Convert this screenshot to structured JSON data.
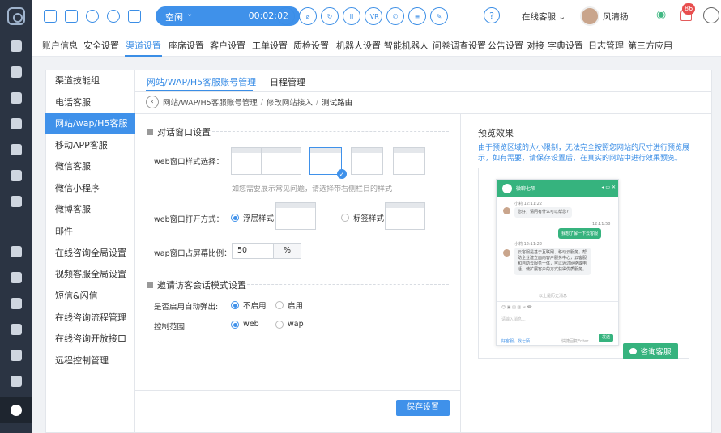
{
  "topbar": {
    "status": "空闲",
    "timer": "00:02:02",
    "controls": [
      "⟲",
      "⌀",
      "↻",
      "II",
      "IVR",
      "✆",
      "≡",
      "✎"
    ],
    "help": "?",
    "agent_status": "在线客服",
    "username": "风清扬",
    "notification_count": "86"
  },
  "menu": [
    "账户信息",
    "安全设置",
    "渠道设置",
    "座席设置",
    "客户设置",
    "工单设置",
    "质检设置",
    "机器人设置",
    "智能机器人",
    "问卷调查设置",
    "公告设置",
    "对接",
    "字典设置",
    "日志管理",
    "第三方应用"
  ],
  "subnav": [
    "渠道技能组",
    "电话客服",
    "网站/wap/H5客服",
    "移动APP客服",
    "微信客服",
    "微信小程序",
    "微博客服",
    "邮件",
    "在线咨询全局设置",
    "视频客服全局设置",
    "短信&闪信",
    "在线咨询流程管理",
    "在线咨询开放接口",
    "远程控制管理"
  ],
  "tabs": [
    "网站/WAP/H5客服账号管理",
    "日程管理"
  ],
  "breadcrumb": {
    "back": "‹",
    "path1": "网站/WAP/H5客服账号管理",
    "sep1": "/",
    "path2": "修改网站接入",
    "sep2": "/",
    "current": "测试路由"
  },
  "form": {
    "section1": "对话窗口设置",
    "style_label": "web窗口样式选择：",
    "style_hint": "如您需要展示常见问题，请选择带右侧栏目的样式",
    "open_label": "web窗口打开方式：",
    "open_float": "浮层样式",
    "open_tab": "标签样式",
    "ratio_label": "wap窗口占屏幕比例：",
    "ratio_value": "50",
    "ratio_unit": "%",
    "section2": "邀请访客会话模式设置",
    "auto_label": "是否启用自动弹出:",
    "auto_off": "不启用",
    "auto_on": "启用",
    "scope_label": "控制范围",
    "scope_web": "web",
    "scope_wap": "wap",
    "save": "保存设置"
  },
  "preview": {
    "title": "预览效果",
    "desc": "由于预览区域的大小限制，无法完全按照您网站的尺寸进行预览展示，如有需要，请保存设置后，在真实的网站中进行效果预览。",
    "phone_title": "微聊七陌",
    "t1": "小莉 12:11:22",
    "msg1": "您好，请问有什么可以帮您?",
    "t2": "12:11:58",
    "msg2": "我想了解一下云客服",
    "t3": "小莉 12:11:22",
    "msg3": "云客服是基于互联网、移动云服务，帮助企业建立面向客户服务中心，云客服和自助云服务一体，可以通过网络或电话，使扩展客户的方式获得优质服务。",
    "divider_text": "以上是历史消息",
    "input_placeholder": "请输入消息...",
    "footer_left": "好客服，找七陌",
    "footer_right": "快捷回复Enter",
    "send": "发送",
    "consult": "咨询客服"
  }
}
